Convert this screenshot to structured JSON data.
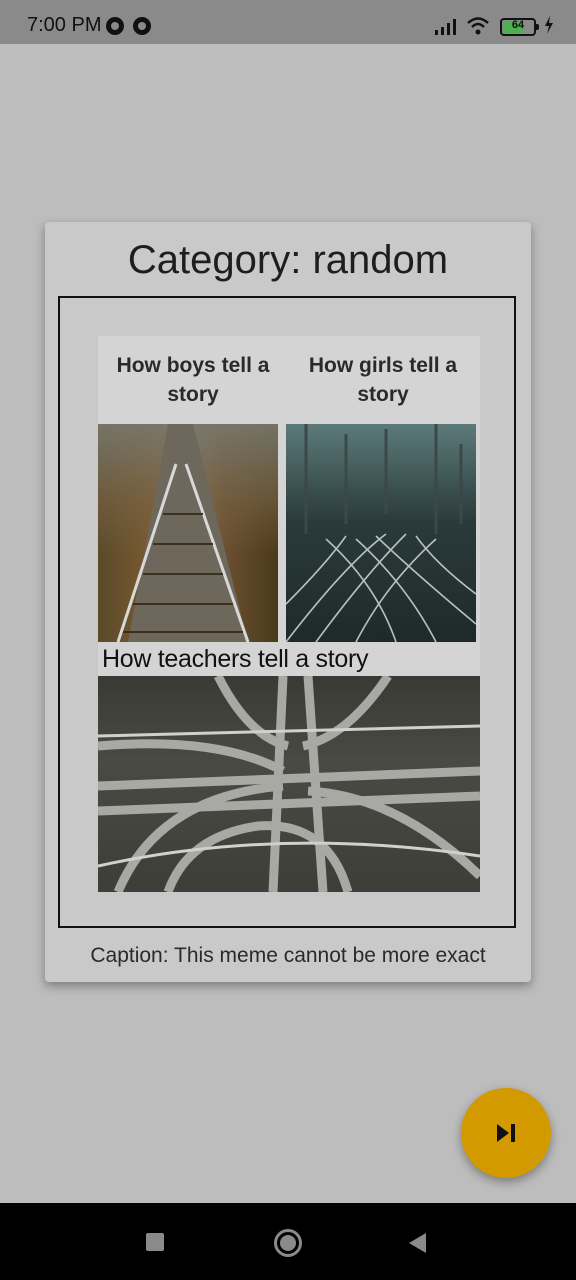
{
  "status_bar": {
    "time": "7:00 PM",
    "battery_level": "64",
    "icons": [
      "notification-icon",
      "notification-icon",
      "signal-icon",
      "wifi-icon",
      "battery-icon",
      "charging-icon"
    ]
  },
  "card": {
    "title": "Category: random",
    "meme": {
      "label_boys": "How boys tell a story",
      "label_girls": "How girls tell a story",
      "label_teachers": "How teachers tell a story"
    },
    "caption": "Caption: This meme cannot be more exact"
  },
  "fab": {
    "icon": "skip-next-icon",
    "color": "#d39a00"
  },
  "nav_bar": {
    "icons": [
      "recent-apps-icon",
      "home-icon",
      "back-icon"
    ]
  }
}
